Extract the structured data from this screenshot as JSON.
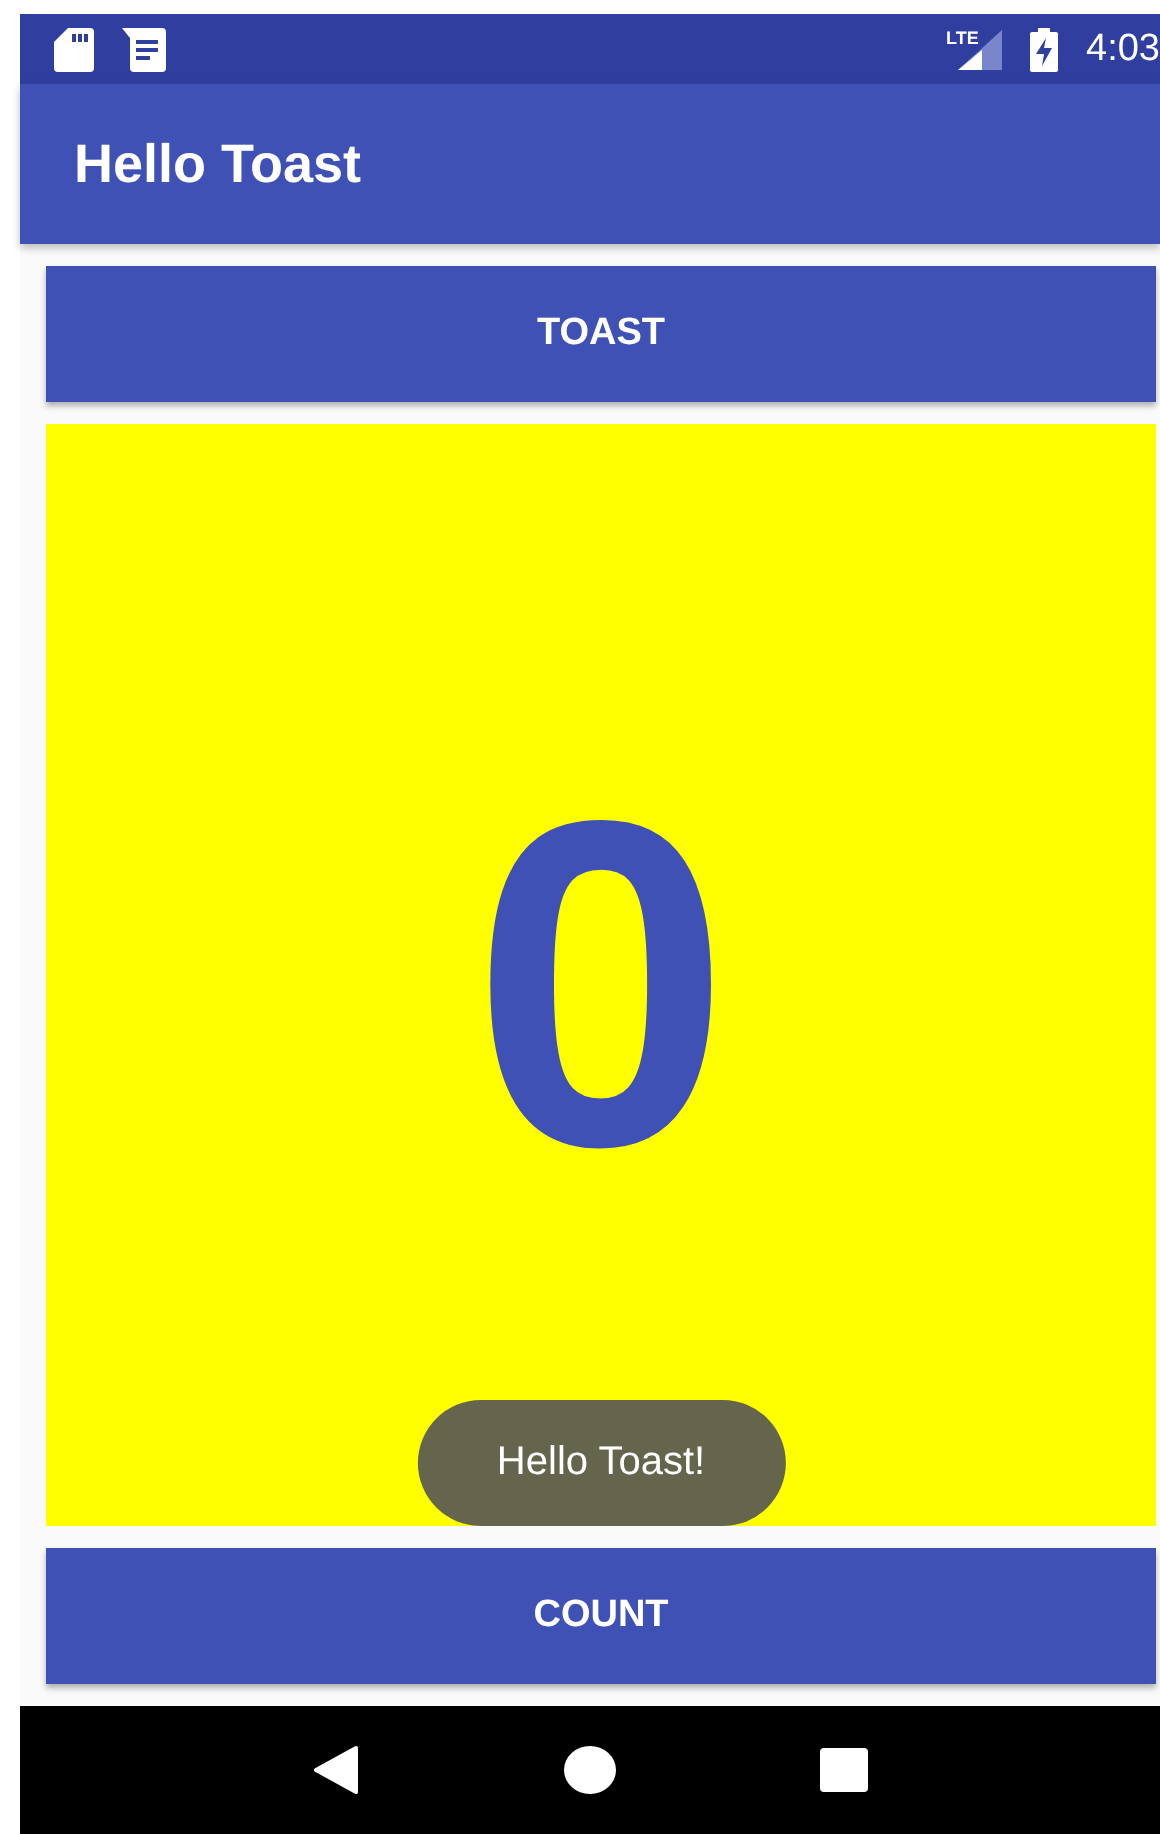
{
  "status_bar": {
    "network": "LTE",
    "time": "4:03"
  },
  "app_bar": {
    "title": "Hello Toast"
  },
  "toast_button": {
    "label": "TOAST"
  },
  "count_display": {
    "value": "0"
  },
  "toast": {
    "message": "Hello Toast!"
  },
  "count_button": {
    "label": "COUNT"
  }
}
